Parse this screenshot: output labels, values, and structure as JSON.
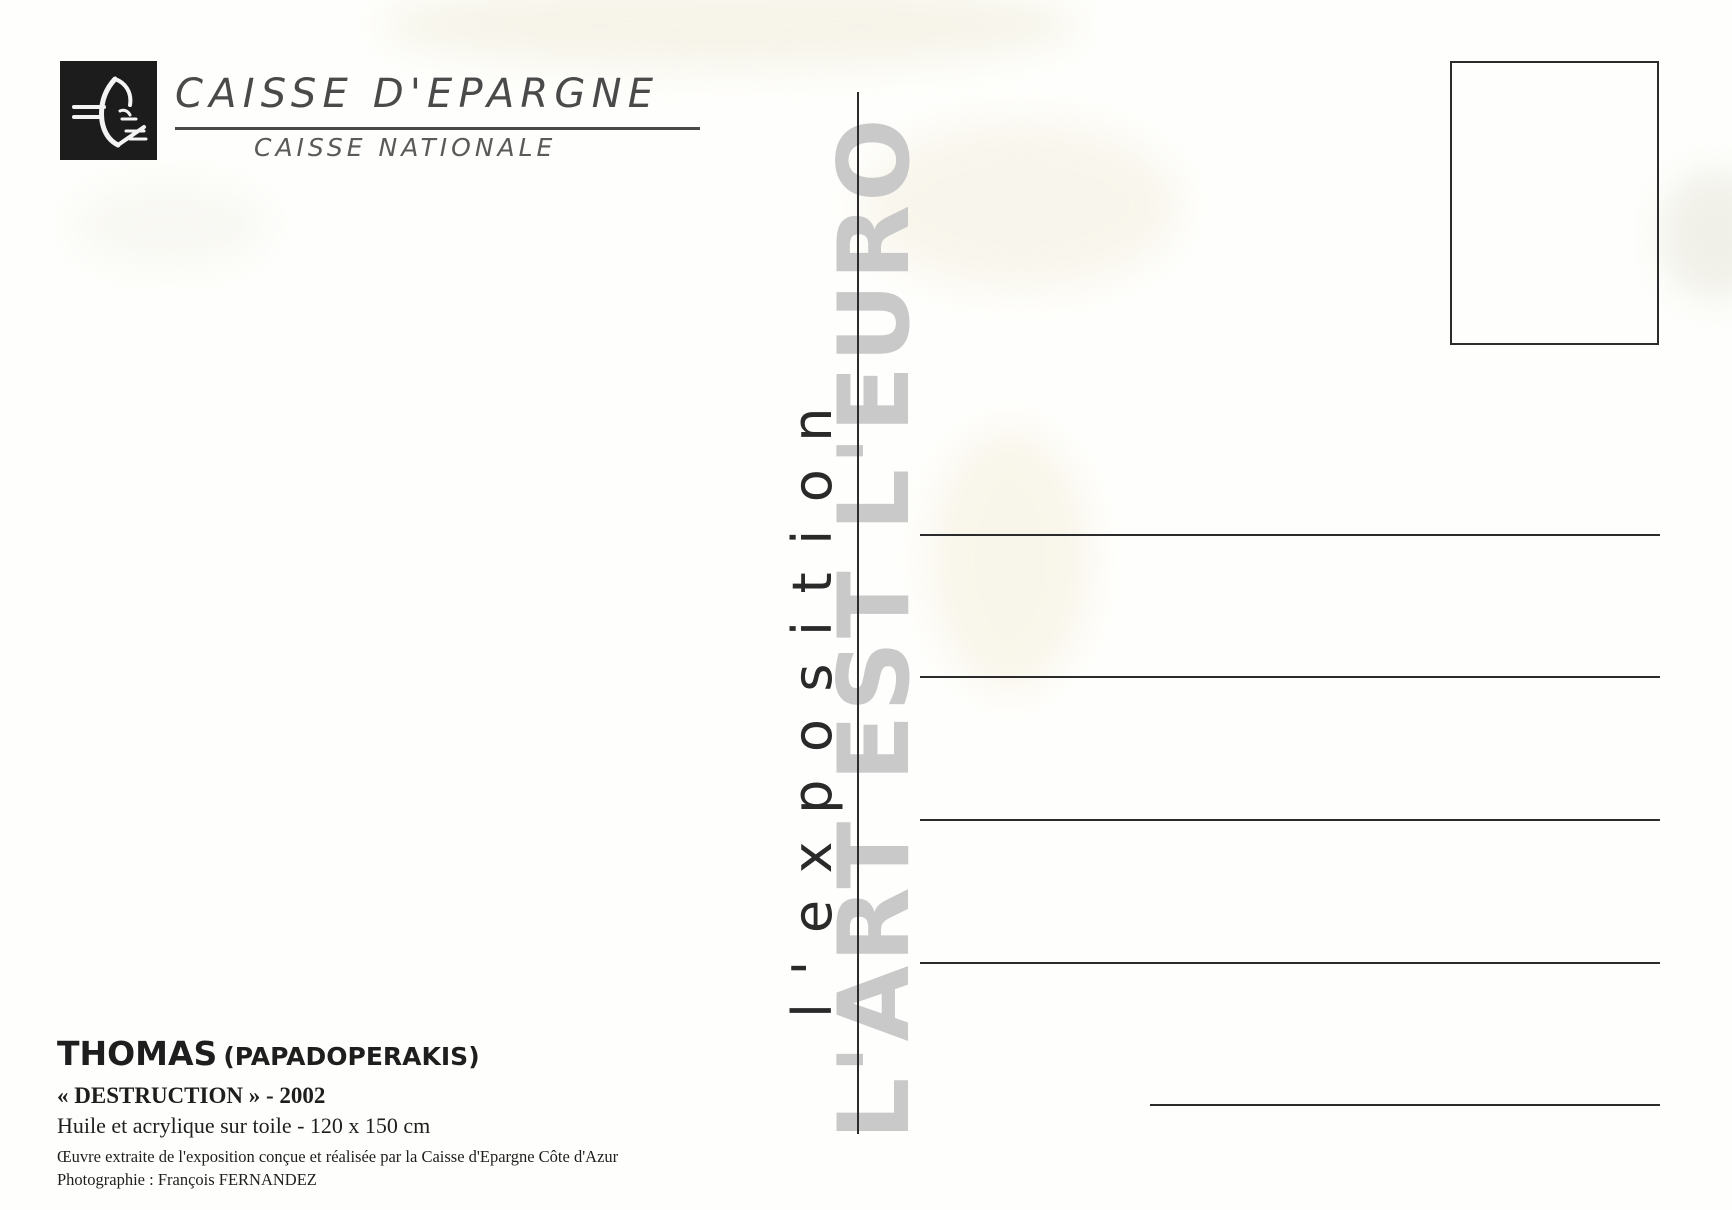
{
  "brand": {
    "name": "CAISSE D'EPARGNE",
    "subtitle": "CAISSE NATIONALE"
  },
  "exhibition": {
    "title_large": "L'ART EST L'EURO",
    "title_small": "l'exposition"
  },
  "caption": {
    "artist": "THOMAS",
    "artist_real_name": "(PAPADOPERAKIS)",
    "work": "« DESTRUCTION » - 2002",
    "medium": "Huile et acrylique sur toile - 120 x 150 cm",
    "credit_exhibition": "Œuvre extraite de l'exposition conçue et réalisée par la Caisse d'Epargne Côte d'Azur",
    "credit_photo": "Photographie : François FERNANDEZ"
  },
  "colors": {
    "logo_background": "#1c1c1c",
    "brand_text": "#4a4a4a",
    "title_large": "#c9c9c9",
    "lines": "#2b2b2b"
  },
  "icons": {
    "logo": "squirrel-euro-logo-icon"
  }
}
